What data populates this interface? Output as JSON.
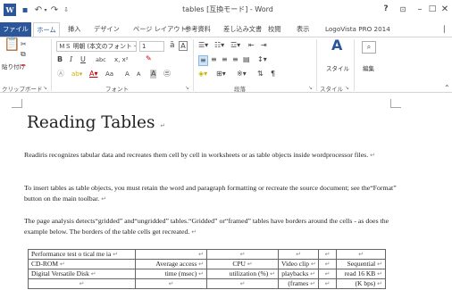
{
  "title_bar": {
    "app_icon": "W",
    "title": "tables [互換モード] - Word",
    "help": "?",
    "ribbon_display": "⊡",
    "minimize": "–",
    "maximize": "□",
    "close": "✕",
    "icons": [
      "word-app-icon",
      "save-icon",
      "undo-icon",
      "redo-icon",
      "customize-qat-icon"
    ]
  },
  "tabs": [
    {
      "label": "ファイル",
      "active": false
    },
    {
      "label": "ホーム",
      "active": true
    },
    {
      "label": "挿入",
      "active": false
    },
    {
      "label": "デザイン",
      "active": false
    },
    {
      "label": "ページ レイアウト",
      "active": false
    },
    {
      "label": "参考資料",
      "active": false
    },
    {
      "label": "差し込み文書",
      "active": false
    },
    {
      "label": "校閲",
      "active": false
    },
    {
      "label": "表示",
      "active": false
    },
    {
      "label": "LogoVista PRO 2014",
      "active": false
    }
  ],
  "ribbon": {
    "clipboard": {
      "label": "クリップボード",
      "paste": "貼り付け"
    },
    "font": {
      "label": "フォント",
      "font_name": "ＭＳ 明朝 (本文のフォント - ",
      "font_size": "1",
      "bold": "B",
      "italic": "I",
      "underline": "U",
      "strike": "abc",
      "subsup": "x, x²",
      "case": "Aa",
      "grow": "A",
      "shrink": "A",
      "shade": "A"
    },
    "paragraph": {
      "label": "段落"
    },
    "styles": {
      "label": "スタイル",
      "button": "スタイル"
    },
    "editing": {
      "button": "編集"
    }
  },
  "document": {
    "heading": "Reading Tables",
    "paragraphs": [
      "Readiris recognizes tabular data and recreates them cell by cell in worksheets or as table objects inside wordprocessor files.",
      "To insert tables as table objects,    you must retain the word and paragraph formatting or recreate the source document; see the“Format” button on the main toolbar.",
      "The page analysis detects“gridded” and“ungridded” tables.“Gridded” or“framed” tables have borders around the cells - as does the example below. The borders of the table cells get recreated."
    ],
    "table": [
      [
        "Performance test o tical me ia",
        "",
        "",
        "",
        "",
        ""
      ],
      [
        "CD-ROM",
        "Average access",
        "CPU",
        "Video clip",
        "",
        "Sequential"
      ],
      [
        "Digital Versatile Disk",
        "time (msec)",
        "utilization (%)",
        "playbacks",
        "",
        "read 16 KB"
      ],
      [
        "",
        "",
        "",
        "(frames",
        "",
        "(K bps)"
      ]
    ]
  }
}
